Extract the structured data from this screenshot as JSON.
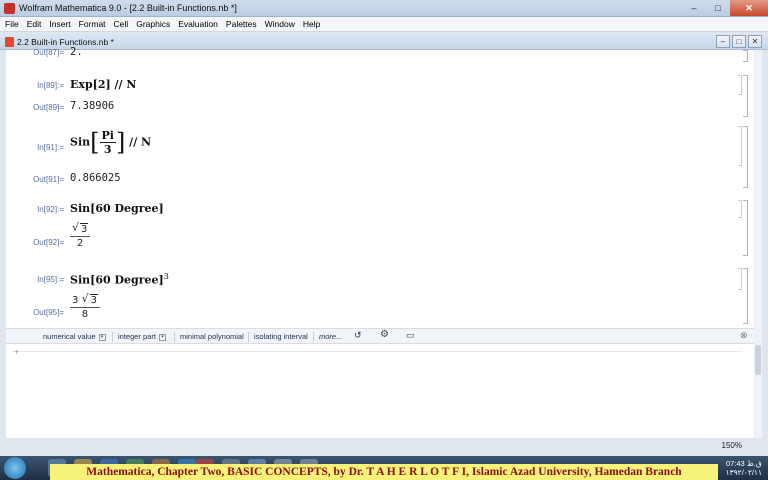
{
  "window": {
    "title": "Wolfram Mathematica 9.0 - [2.2 Built-in Functions.nb *]",
    "minimize": "–",
    "maximize": "□",
    "close": "✕"
  },
  "menu": [
    "File",
    "Edit",
    "Insert",
    "Format",
    "Cell",
    "Graphics",
    "Evaluation",
    "Palettes",
    "Window",
    "Help"
  ],
  "notebook": {
    "title": "2.2 Built-in Functions.nb *",
    "cells": [
      {
        "out_label": "Out[87]=",
        "out_value": "2."
      },
      {
        "in_label": "In[89]:=",
        "in_text": "Exp[2] // N",
        "out_label": "Out[89]=",
        "out_value": "7.38906"
      },
      {
        "in_label": "In[91]:=",
        "in_head": "Sin",
        "in_num": "Pi",
        "in_den": "3",
        "in_tail": "// N",
        "out_label": "Out[91]=",
        "out_value": "0.866025"
      },
      {
        "in_label": "In[92]:=",
        "in_text": "Sin[60 Degree]",
        "out_label": "Out[92]=",
        "out_rad": "3",
        "out_den": "2"
      },
      {
        "in_label": "In[95]:=",
        "in_text": "Sin[60 Degree]",
        "in_exp": "3",
        "out_label": "Out[95]=",
        "out_coef": "3",
        "out_rad": "3",
        "out_den": "8"
      }
    ]
  },
  "suggestions": {
    "items": [
      "numerical value",
      "integer part",
      "minimal polynomial",
      "isolating interval"
    ],
    "more": "more..."
  },
  "zoom": "150%",
  "taskbar": {
    "clock_time": "07:43",
    "clock_suffix": "ق.ظ",
    "clock_date": "۱۳۹۲/۰۲/۱۱"
  },
  "caption": "Mathematica, Chapter Two, BASIC CONCEPTS,  by Dr. T A H E R    L O T F I, Islamic Azad University, Hamedan Branch"
}
